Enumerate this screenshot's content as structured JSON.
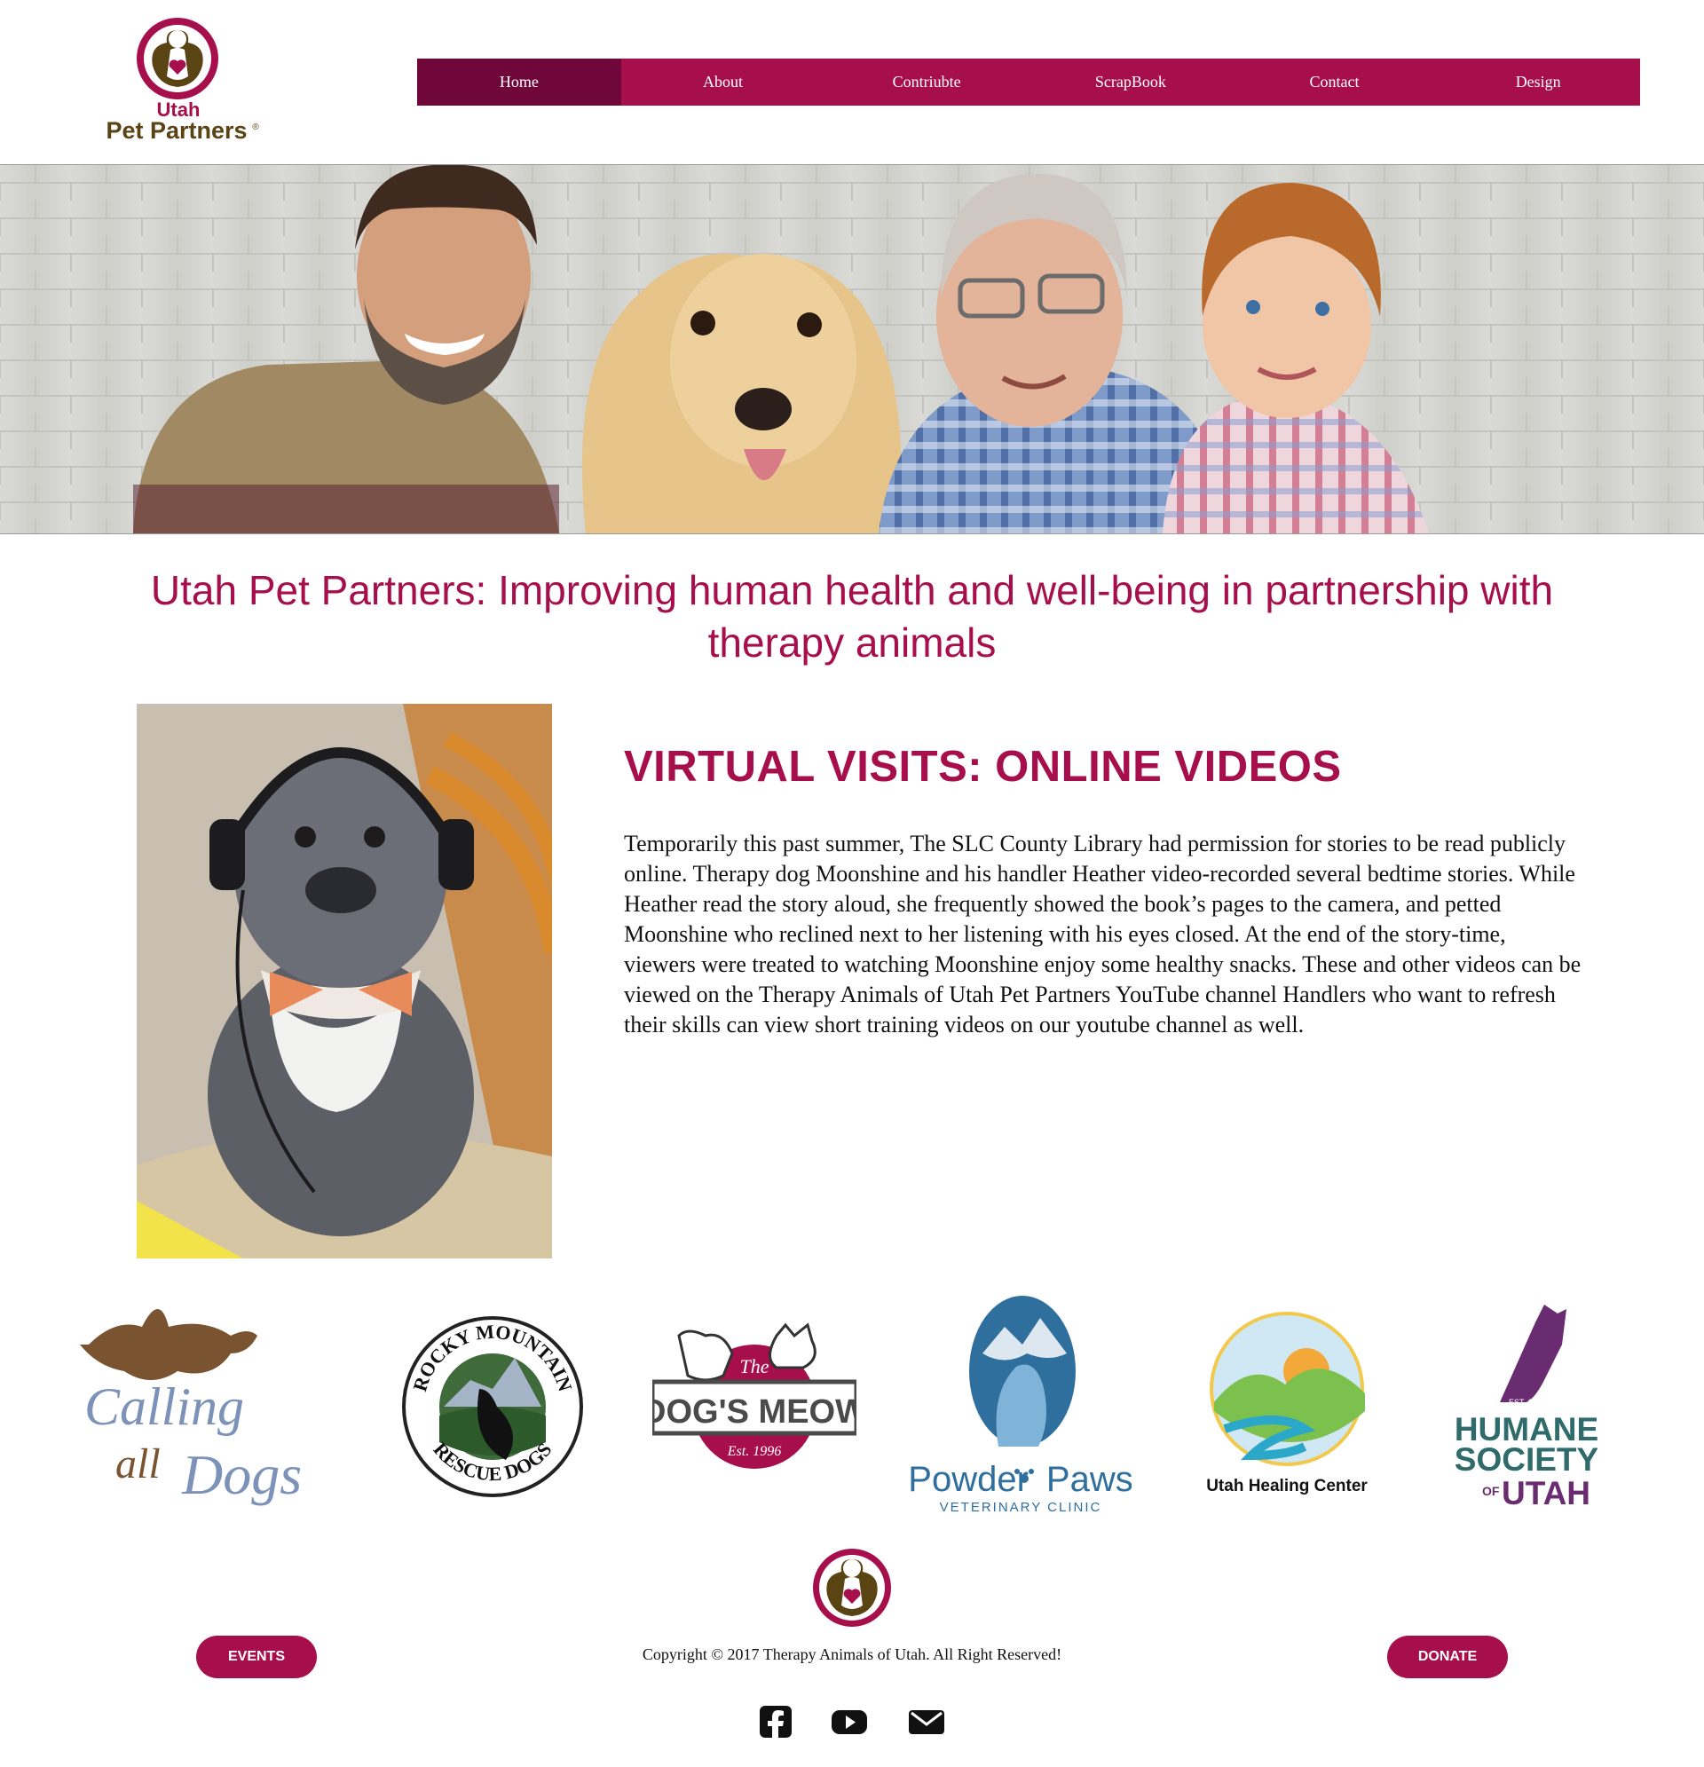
{
  "header": {
    "logo": {
      "line1": "Utah",
      "line2": "Pet Partners",
      "mark": "®"
    },
    "nav": [
      {
        "label": "Home",
        "active": true
      },
      {
        "label": "About"
      },
      {
        "label": "Contriubte"
      },
      {
        "label": "ScrapBook"
      },
      {
        "label": "Contact"
      },
      {
        "label": "Design"
      }
    ]
  },
  "hero": {
    "image": "man-dog-grandfather-boy-photo"
  },
  "main": {
    "headline": "Utah Pet Partners: Improving human health and well-being in partnership with therapy animals",
    "feature": {
      "image": "dog-with-headphones-photo",
      "heading": "VIRTUAL VISITS: ONLINE VIDEOS",
      "body": "Temporarily this past summer, The SLC County Library had permission for stories to be read publicly online. Therapy dog Moonshine and his handler Heather video-recorded several bedtime stories. While Heather read the story aloud, she frequently showed the book’s pages to the camera, and petted Moonshine who reclined next to her listening with his eyes closed. At the end of the story-time, viewers were treated to watching Moonshine enjoy some healthy snacks. These and other videos can be viewed on the Therapy Animals of Utah Pet Partners YouTube channel Handlers who want to refresh their skills can view short training videos on our youtube channel as well."
    }
  },
  "partners": {
    "calling_all_dogs": {
      "line1": "Calling",
      "line2": "all",
      "line3": "Dogs"
    },
    "rocky_mountain": {
      "top": "ROCKY MOUNTAIN",
      "bottom": "RESCUE DOGS"
    },
    "dogs_meow": {
      "the": "The",
      "name": "DOG'S MEOW",
      "est": "Est. 1996"
    },
    "powder_paws": {
      "name1": "Powder",
      "name2": "Paws",
      "sub": "VETERINARY CLINIC"
    },
    "utah_healing": {
      "name": "Utah Healing Center"
    },
    "humane_society": {
      "est": "EST. 1960",
      "line1": "HUMANE",
      "line2": "SOCIETY",
      "of": "OF",
      "line3": "UTAH"
    }
  },
  "footer": {
    "events_label": "EVENTS",
    "donate_label": "DONATE",
    "copyright": "Copyright © 2017 Therapy Animals of Utah. All Right Reserved!",
    "social": [
      "facebook-icon",
      "youtube-icon",
      "email-icon"
    ]
  },
  "colors": {
    "brand": "#a70f4c",
    "brand_dark": "#70073a",
    "logo_brown": "#5a4413"
  }
}
